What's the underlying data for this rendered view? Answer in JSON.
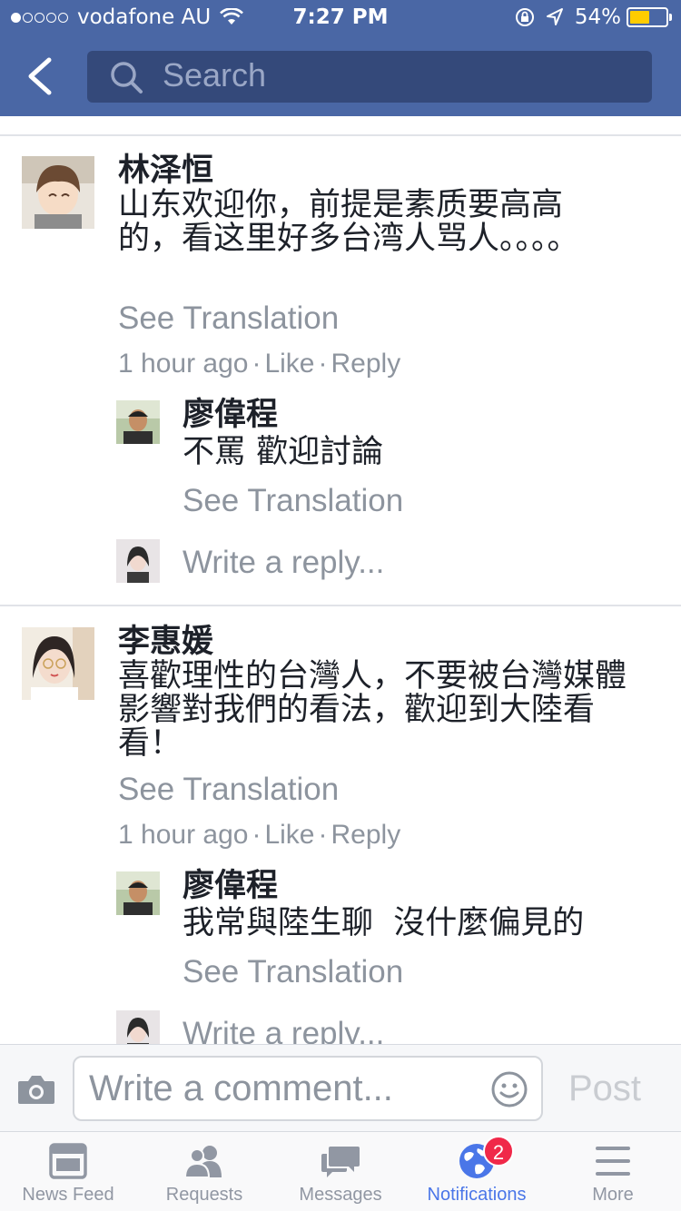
{
  "status_bar": {
    "carrier": "vodafone AU",
    "time": "7:27 PM",
    "battery": "54%",
    "battery_level": 0.54,
    "signal_bars_filled": 1
  },
  "header": {
    "search_placeholder": "Search",
    "background": "#4a67a5"
  },
  "comments": [
    {
      "author": "林泽恒",
      "text": "山东欢迎你，前提是素质要高高的，看这里好多台湾人骂人。。。。",
      "see_translation": "See Translation",
      "time": "1 hour ago",
      "like": "Like",
      "reply": "Reply",
      "replies": [
        {
          "author": "廖偉程",
          "text": "不罵 歡迎討論",
          "see_translation": "See Translation"
        }
      ],
      "reply_prompt": "Write a reply..."
    },
    {
      "author": "李惠媛",
      "text": "喜歡理性的台灣人，不要被台灣媒體影響對我們的看法，歡迎到大陸看看！",
      "see_translation": "See Translation",
      "time": "1 hour ago",
      "like": "Like",
      "reply": "Reply",
      "replies": [
        {
          "author": "廖偉程",
          "text": "我常與陸生聊  沒什麼偏見的",
          "see_translation": "See Translation"
        }
      ],
      "reply_prompt": "Write a reply..."
    }
  ],
  "composer": {
    "placeholder": "Write a comment...",
    "post_label": "Post"
  },
  "tabs": [
    {
      "label": "News Feed",
      "icon": "news-feed-icon"
    },
    {
      "label": "Requests",
      "icon": "friend-requests-icon"
    },
    {
      "label": "Messages",
      "icon": "messages-icon"
    },
    {
      "label": "Notifications",
      "icon": "globe-icon",
      "badge": "2",
      "active": true
    },
    {
      "label": "More",
      "icon": "menu-icon"
    }
  ],
  "colors": {
    "link_gray": "#8d949e",
    "active_tab": "#4a76e8",
    "badge": "#f02849"
  }
}
